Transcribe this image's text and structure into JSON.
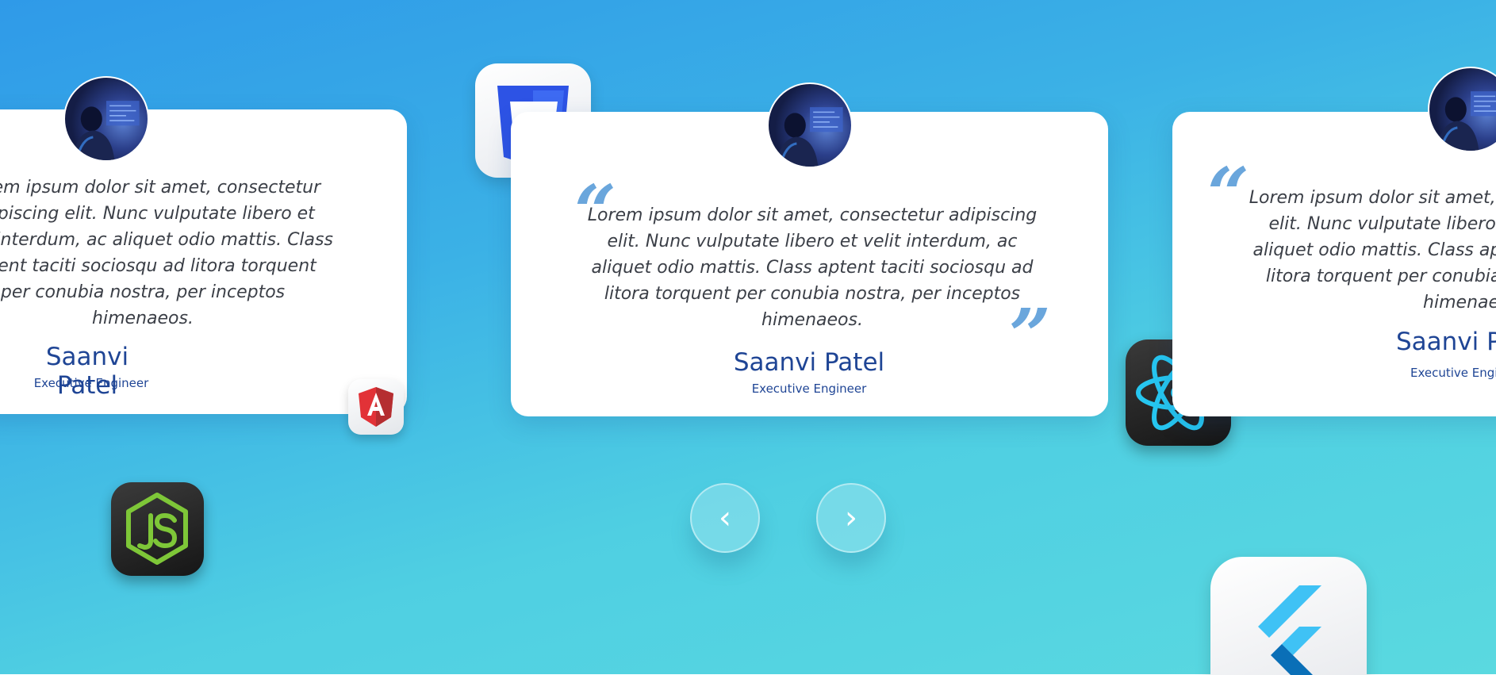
{
  "testimonials": [
    {
      "quote": "Lorem ipsum dolor sit amet, consectetur adipiscing elit. Nunc vulputate libero et velit interdum, ac aliquet odio mattis. Class aptent taciti sociosqu ad litora torquent per conubia nostra, per inceptos himenaeos.",
      "name": "Saanvi Patel",
      "role": "Executive Engineer"
    },
    {
      "quote": "Lorem ipsum dolor sit amet, consectetur adipiscing elit. Nunc vulputate libero et velit interdum, ac aliquet odio mattis. Class aptent taciti sociosqu ad litora torquent per conubia nostra, per inceptos himenaeos.",
      "name": "Saanvi Patel",
      "role": "Executive Engineer"
    },
    {
      "quote": "Lorem ipsum dolor sit amet, consectetur adipiscing elit. Nunc vulputate libero et velit interdum, ac aliquet odio mattis. Class aptent taciti sociosqu ad litora torquent per conubia nostra, per inceptos himenaeos.",
      "name": "Saanvi Patel",
      "role": "Executive Engineer"
    }
  ],
  "quote_marks": {
    "open": "“",
    "close": "”"
  },
  "navigation": {
    "prev_icon": "‹",
    "next_icon": "›"
  },
  "icons": [
    "css3-icon",
    "angular-icon",
    "nodejs-icon",
    "react-icon",
    "flutter-icon",
    "chevron-left-icon",
    "chevron-right-icon"
  ],
  "colors": {
    "background_top": "#2f9ae8",
    "background_bottom": "#5ad9e0",
    "card": "#ffffff",
    "name_text": "#1f4595",
    "quote_mark": "#6aa6dc",
    "body_text": "#3b3f47"
  }
}
